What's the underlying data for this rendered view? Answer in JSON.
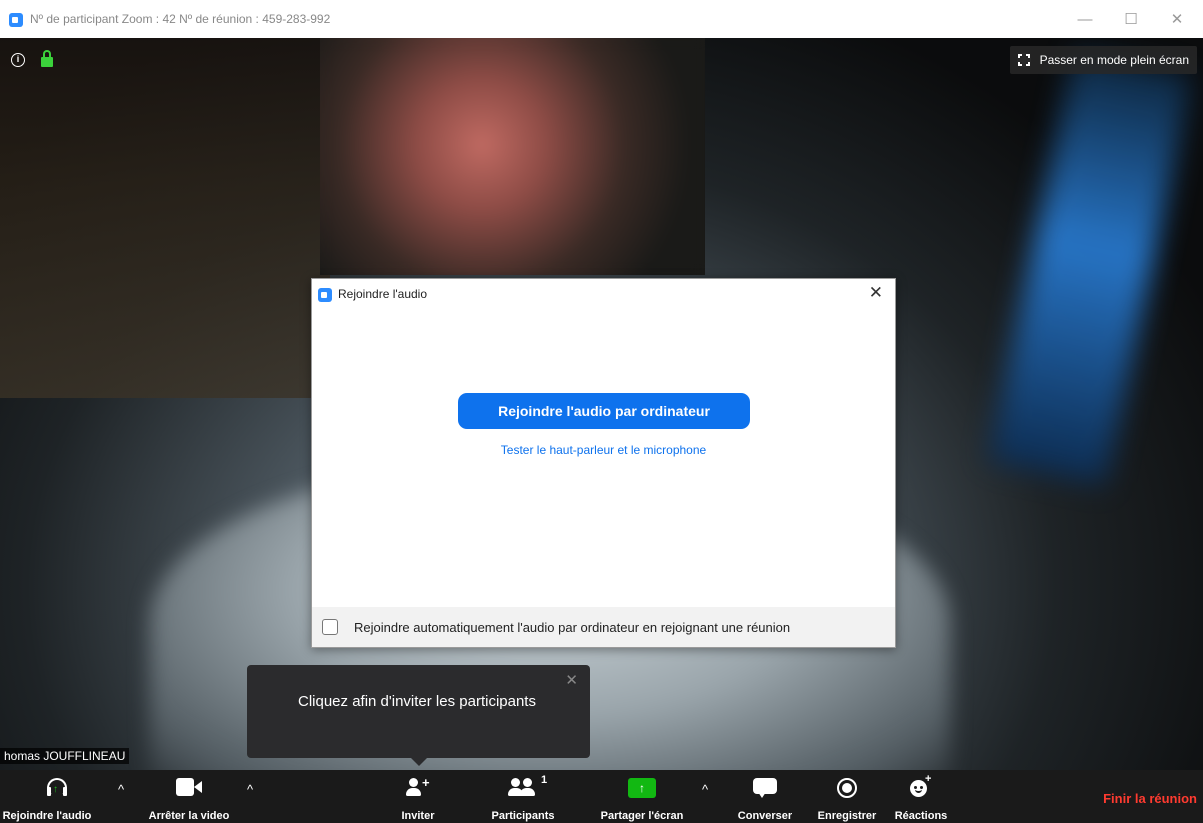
{
  "window": {
    "title": "Nº de participant Zoom : 42   Nº de réunion : 459-283-992",
    "minimize": "—",
    "maximize": "☐",
    "close": "✕"
  },
  "stage": {
    "fullscreen_label": "Passer en mode plein écran",
    "name_badge": "homas JOUFFLINEAU"
  },
  "dialog": {
    "title": "Rejoindre l'audio",
    "close": "✕",
    "primary_button": "Rejoindre l'audio par ordinateur",
    "test_link": "Tester le haut-parleur et le microphone",
    "auto_join_checkbox": "Rejoindre automatiquement l'audio par ordinateur en rejoignant une réunion",
    "auto_join_checked": false
  },
  "tooltip": {
    "text": "Cliquez afin d'inviter les participants",
    "close": "✕"
  },
  "toolbar": {
    "join_audio": "Rejoindre l'audio",
    "stop_video": "Arrêter la video",
    "invite": "Inviter",
    "participants": "Participants",
    "participants_count": "1",
    "share_screen": "Partager l'écran",
    "chat": "Converser",
    "record": "Enregistrer",
    "reactions": "Réactions",
    "end_meeting": "Finir la réunion",
    "caret": "^"
  },
  "colors": {
    "accent": "#0e72ed",
    "share_green": "#12b812",
    "end_red": "#ff3b30",
    "lock_green": "#3bd23b"
  }
}
